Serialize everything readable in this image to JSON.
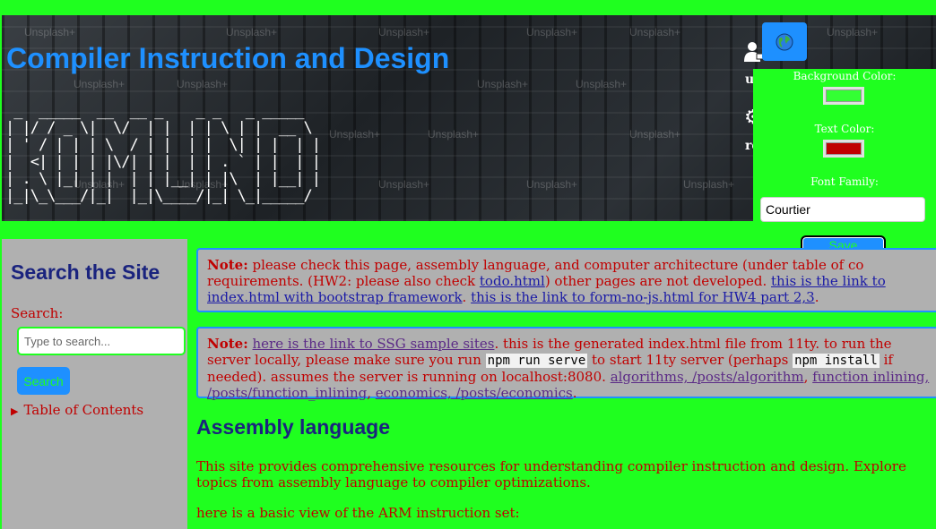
{
  "header": {
    "title": "Compiler Instruction and Design",
    "ascii_art": " _  _____  __  __ _    _ _   _ _____  \n| |/ / _ \\|  \\/  | |  | | \\ | |  __ \\ \n| ' / | | | \\  / | |  | |  \\| | |  | |\n|  <| | | | |\\/| | |  | | . ` | |  | |\n| . \\ |_| | |  | | |__| | |\\  | |__| |\n|_|\\_\\___/|_|  |_|\\____/|_| \\_|_____/ ",
    "watermark": "Unsplash+",
    "user_label": "u",
    "puzzle_label": "re"
  },
  "theme": {
    "bg_label": "Background Color:",
    "bg_color": "#33ff33",
    "text_label": "Text Color:",
    "text_color": "#c00000",
    "font_label": "Font Family:",
    "font_value": "Courtier",
    "save_label": "Save Theme"
  },
  "sidebar": {
    "heading": "Search the Site",
    "search_label": "Search:",
    "search_placeholder": "Type to search...",
    "search_button": "Search",
    "toc_label": "Table of Contents"
  },
  "notes": {
    "n1": {
      "bold": "Note:",
      "t1": "please check this page, assembly language, and computer architecture (under table of co",
      "t2": "requirements. (HW2: please also check",
      "link_todo": "todo.html",
      "t3": ") other pages are not developed.",
      "link_index": "this is the link to index.html with bootstrap framework",
      "t4": ".",
      "link_form": "this is the link to form-no-js.html for HW4 part 2,3",
      "t5": "."
    },
    "n2": {
      "bold": "Note:",
      "link_ssg": "here is the link to SSG sample sites",
      "t1": ". this is the generated index.html file from 11ty. to run the server locally, please make sure you run",
      "code1": "npm run serve",
      "t2": "to start 11ty server (perhaps",
      "code2": "npm install",
      "t3": "if needed). assumes the server is running on localhost:8080.",
      "link_alg": "algorithms, /posts/algorithm",
      "sep1": ",",
      "link_fi": "function inlining, /posts/function_inlining",
      "sep2": ",",
      "link_eco": "economics, /posts/economics",
      "t4": "."
    }
  },
  "main": {
    "section_title": "Assembly language",
    "intro": "This site provides comprehensive resources for understanding compiler instruction and design. Explore topics from assembly language to compiler optimizations.",
    "arm_text": "here is a basic view of the ARM instruction set:"
  },
  "icons": {
    "globe": "globe-icon",
    "user": "user-icon",
    "puzzle": "puzzle-icon"
  }
}
